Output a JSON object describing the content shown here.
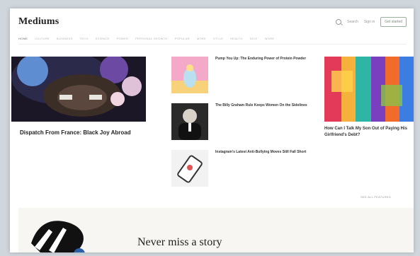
{
  "header": {
    "logo": "Mediums",
    "search_label": "Search",
    "signin": "Sign in",
    "get_started": "Get started"
  },
  "nav": {
    "items": [
      "HOME",
      "CULTURE",
      "BUSINESS",
      "TECH",
      "SCIENCE",
      "POWER",
      "PERSONAL GROWTH",
      "POPULAR",
      "MORE",
      "STYLE",
      "HEALTH",
      "SELF",
      "WORK"
    ]
  },
  "hero": {
    "title": "Dispatch From France: Black Joy Abroad",
    "subtitle": "",
    "author": "",
    "time": ""
  },
  "mid_items": [
    {
      "title": "Pump You Up: The Enduring Power of Protein Powder",
      "author": "",
      "time": ""
    },
    {
      "title": "The Billy Graham Rule Keeps Women On the Sidelines",
      "author": "",
      "time": ""
    },
    {
      "title": "Instagram's Latest Anti-Bullying Moves Still Fall Short",
      "author": "",
      "time": ""
    }
  ],
  "right": {
    "title": "How Can I Talk My Son Out of Paying His Girlfriend's Debt?",
    "subtitle": "",
    "author": "",
    "time": ""
  },
  "see_all": "SEE ALL FEATURED",
  "promo": {
    "title": "Never miss a story",
    "text": ""
  },
  "colors": {
    "background": "#cfd6dc",
    "page": "#ffffff",
    "accent_green": "#9ab09a"
  }
}
